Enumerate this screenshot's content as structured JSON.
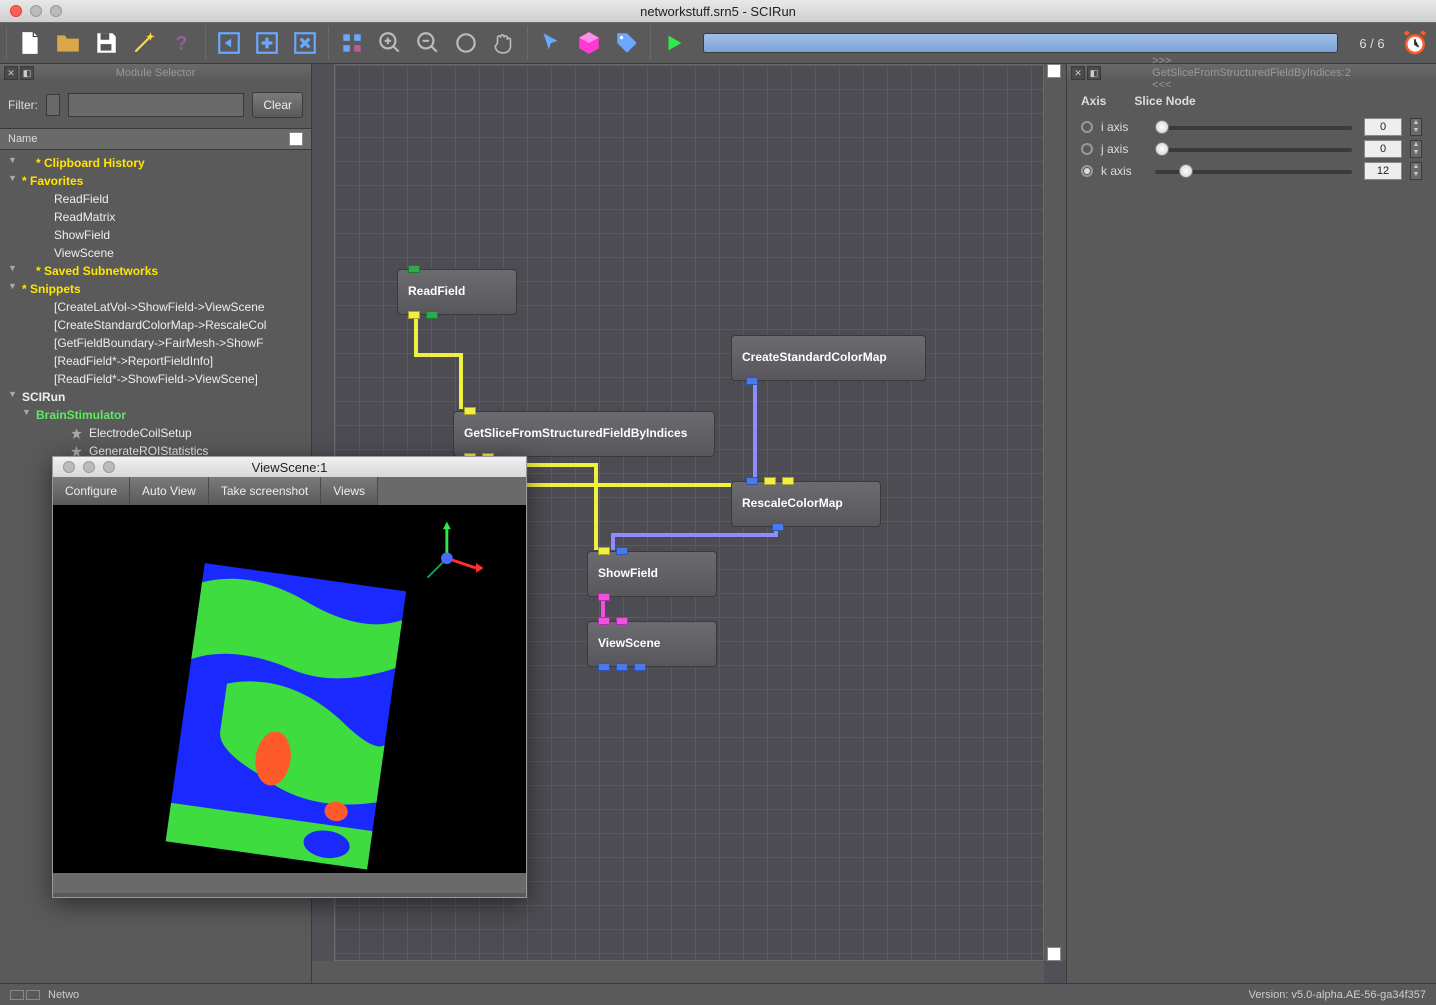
{
  "window_title": "networkstuff.srn5 - SCIRun",
  "progress": {
    "count": "6 / 6",
    "percent": 100
  },
  "module_selector": {
    "panel_title": "Module Selector",
    "filter_label": "Filter:",
    "clear_label": "Clear",
    "name_header": "Name",
    "tree": {
      "clipboard": "* Clipboard History",
      "favorites": "* Favorites",
      "fav_items": [
        "ReadField",
        "ReadMatrix",
        "ShowField",
        "ViewScene"
      ],
      "saved": "* Saved Subnetworks",
      "snippets": "* Snippets",
      "snip_items": [
        "[CreateLatVol->ShowField->ViewScene",
        "[CreateStandardColorMap->RescaleCol",
        "[GetFieldBoundary->FairMesh->ShowF",
        "[ReadField*->ReportFieldInfo]",
        "[ReadField*->ShowField->ViewScene]"
      ],
      "scirun": "SCIRun",
      "brain": "BrainStimulator",
      "brain_items": [
        "ElectrodeCoilSetup",
        "GenerateROIStatistics"
      ]
    }
  },
  "modules": {
    "readfield": "ReadField",
    "createcolormap": "CreateStandardColorMap",
    "getslice": "GetSliceFromStructuredFieldByIndices",
    "rescale": "RescaleColorMap",
    "showfield": "ShowField",
    "viewscene": "ViewScene"
  },
  "right_panel": {
    "title": ">>> GetSliceFromStructuredFieldByIndices:2 <<<",
    "axis_header": "Axis",
    "slice_header": "Slice Node",
    "axes": [
      {
        "label": "i axis",
        "value": "0",
        "checked": false,
        "pos": 0
      },
      {
        "label": "j axis",
        "value": "0",
        "checked": false,
        "pos": 0
      },
      {
        "label": "k axis",
        "value": "12",
        "checked": true,
        "pos": 12
      }
    ]
  },
  "viewscene": {
    "title": "ViewScene:1",
    "buttons": [
      "Configure",
      "Auto View",
      "Take screenshot",
      "Views"
    ]
  },
  "status": {
    "left": "Netwo",
    "version": "Version: v5.0-alpha.AE-56-ga34f357"
  }
}
